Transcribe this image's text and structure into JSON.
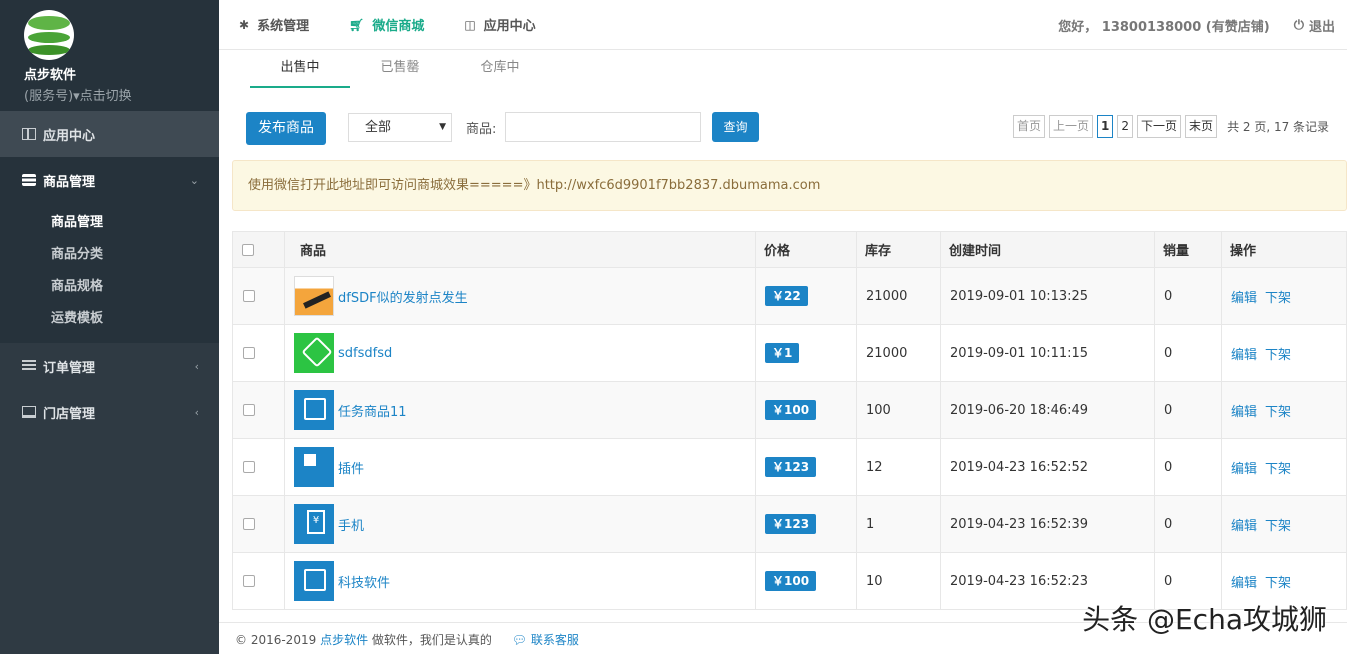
{
  "sidebar": {
    "brand_name": "点步软件",
    "brand_sub": "(服务号)▾点击切换",
    "app_center": "应用中心",
    "goods_mgmt": "商品管理",
    "sub_items": [
      "商品管理",
      "商品分类",
      "商品规格",
      "运费模板"
    ],
    "order_mgmt": "订单管理",
    "store_mgmt": "门店管理"
  },
  "topbar": {
    "menu": [
      "系统管理",
      "微信商城",
      "应用中心"
    ],
    "greeting": "您好， 13800138000 (有赞店铺)",
    "logout": "退出"
  },
  "tabs": [
    "出售中",
    "已售罄",
    "仓库中"
  ],
  "toolbar": {
    "publish": "发布商品",
    "filter_selected": "全部",
    "goods_label": "商品:",
    "query": "查询"
  },
  "pager": {
    "first": "首页",
    "prev": "上一页",
    "pages": [
      "1",
      "2"
    ],
    "next": "下一页",
    "last": "末页",
    "total": "共 2 页, 17 条记录"
  },
  "notice": "使用微信打开此地址即可访问商城效果=====》http://wxfc6d9901f7bb2837.dbumama.com",
  "table": {
    "headers": [
      "商品",
      "价格",
      "库存",
      "创建时间",
      "销量",
      "操作"
    ],
    "ops": [
      "编辑",
      "下架"
    ],
    "rows": [
      {
        "name": "dfSDF似的发射点发生",
        "price": "￥22",
        "stock": "21000",
        "created": "2019-09-01 10:13:25",
        "sales": "0"
      },
      {
        "name": "sdfsdfsd",
        "price": "￥1",
        "stock": "21000",
        "created": "2019-09-01 10:11:15",
        "sales": "0"
      },
      {
        "name": "任务商品11",
        "price": "￥100",
        "stock": "100",
        "created": "2019-06-20 18:46:49",
        "sales": "0"
      },
      {
        "name": "插件",
        "price": "￥123",
        "stock": "12",
        "created": "2019-04-23 16:52:52",
        "sales": "0"
      },
      {
        "name": "手机",
        "price": "￥123",
        "stock": "1",
        "created": "2019-04-23 16:52:39",
        "sales": "0"
      },
      {
        "name": "科技软件",
        "price": "￥100",
        "stock": "10",
        "created": "2019-04-23 16:52:23",
        "sales": "0"
      }
    ]
  },
  "footer": {
    "copyright": "© 2016-2019",
    "company": "点步软件",
    "slogan": "做软件，我们是认真的",
    "service": "联系客服"
  },
  "watermark": "头条 @Echa攻城狮"
}
